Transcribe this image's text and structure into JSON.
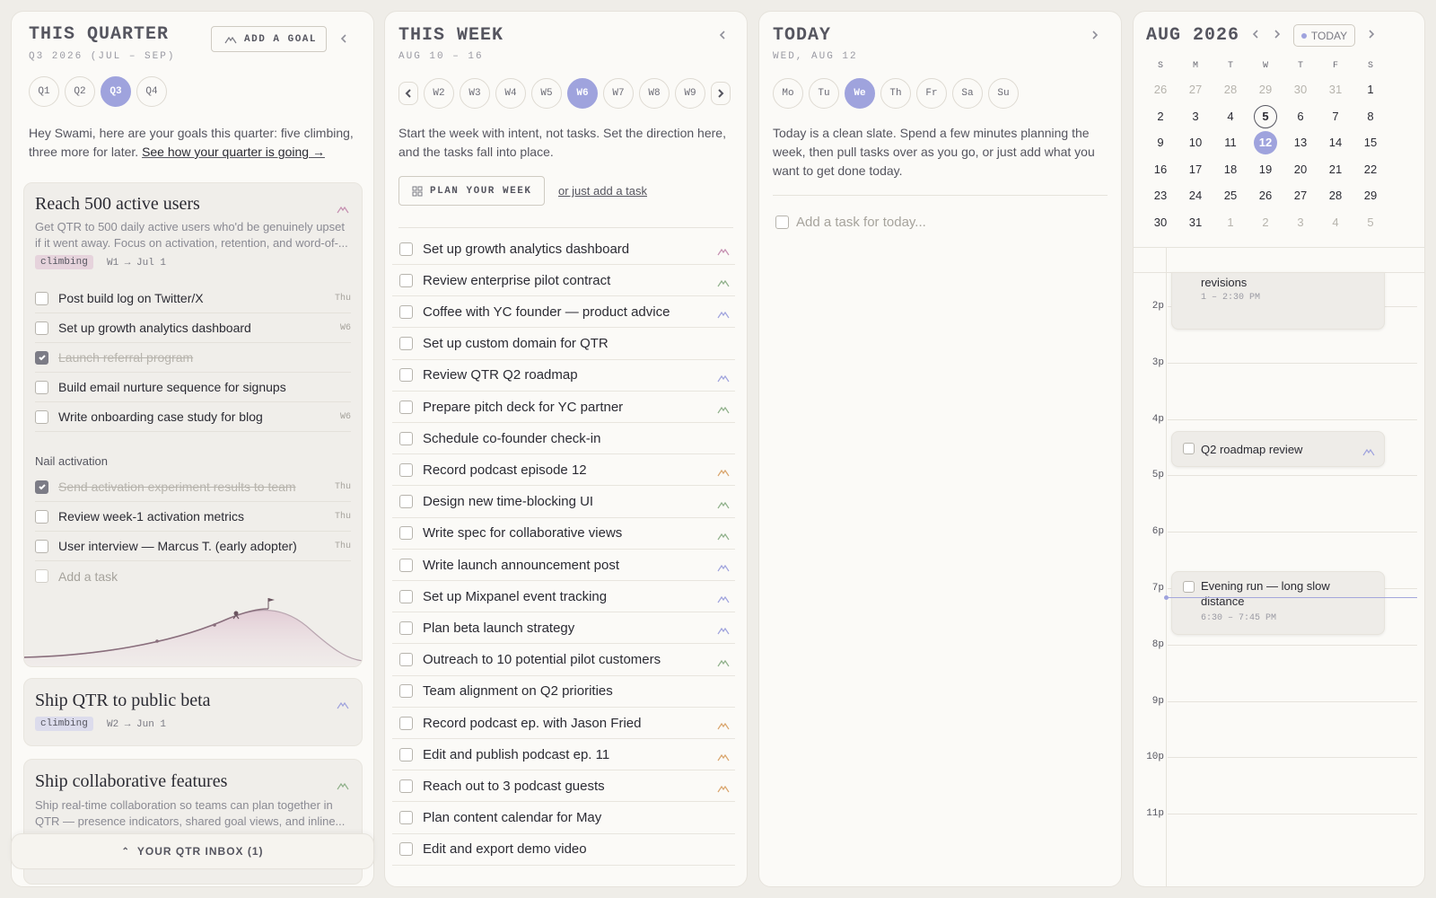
{
  "quarter": {
    "title": "THIS QUARTER",
    "subtitle": "Q3 2026 (JUL – SEP)",
    "add_goal_label": "ADD A GOAL",
    "quarters": [
      "Q1",
      "Q2",
      "Q3",
      "Q4"
    ],
    "active_quarter": "Q3",
    "intro": "Hey Swami, here are your goals this quarter: five climbing, three more for later.",
    "intro_link": "See how your quarter is going →",
    "goals": [
      {
        "title": "Reach 500 active users",
        "description": "Get QTR to 500 daily active users who'd be genuinely upset if it went away. Focus on activation, retention, and word-of-...",
        "status": "climbing",
        "span": "W1 → Jul 1",
        "tasks": [
          {
            "label": "Post build log on Twitter/X",
            "due": "Thu",
            "done": false
          },
          {
            "label": "Set up growth analytics dashboard",
            "due": "W6",
            "done": false
          },
          {
            "label": "Launch referral program",
            "due": "",
            "done": true
          },
          {
            "label": "Build email nurture sequence for signups",
            "due": "",
            "done": false
          },
          {
            "label": "Write onboarding case study for blog",
            "due": "W6",
            "done": false
          }
        ],
        "subgoal_title": "Nail activation",
        "subgoal_tasks": [
          {
            "label": "Send activation experiment results to team",
            "due": "Thu",
            "done": true
          },
          {
            "label": "Review week-1 activation metrics",
            "due": "Thu",
            "done": false
          },
          {
            "label": "User interview — Marcus T. (early adopter)",
            "due": "Thu",
            "done": false
          }
        ],
        "add_task_placeholder": "Add a task",
        "progress": 0.6
      },
      {
        "title": "Ship QTR to public beta",
        "status": "climbing",
        "span": "W2 → Jun 1"
      },
      {
        "title": "Ship collaborative features",
        "description": "Ship real-time collaboration so teams can plan together in QTR — presence indicators, shared goal views, and inline..."
      }
    ],
    "inbox_label": "YOUR QTR INBOX (1)"
  },
  "week": {
    "title": "THIS WEEK",
    "subtitle": "AUG 10 – 16",
    "weeks": [
      "W2",
      "W3",
      "W4",
      "W5",
      "W6",
      "W7",
      "W8",
      "W9"
    ],
    "active_week": "W6",
    "intro": "Start the week with intent, not tasks. Set the direction here, and the tasks fall into place.",
    "plan_label": "PLAN YOUR WEEK",
    "add_task_link": "or just add a task",
    "tasks": [
      {
        "label": "Set up growth analytics dashboard",
        "goal_color": "#c58fb0"
      },
      {
        "label": "Review enterprise pilot contract",
        "goal_color": "#8fb08a"
      },
      {
        "label": "Coffee with YC founder — product advice",
        "goal_color": "#9fa3dd"
      },
      {
        "label": "Set up custom domain for QTR",
        "goal_color": ""
      },
      {
        "label": "Review QTR Q2 roadmap",
        "goal_color": "#9fa3dd"
      },
      {
        "label": "Prepare pitch deck for YC partner",
        "goal_color": "#8fb08a"
      },
      {
        "label": "Schedule co-founder check-in",
        "goal_color": ""
      },
      {
        "label": "Record podcast episode 12",
        "goal_color": "#d9a56c"
      },
      {
        "label": "Design new time-blocking UI",
        "goal_color": "#8fb08a"
      },
      {
        "label": "Write spec for collaborative views",
        "goal_color": "#8fb08a"
      },
      {
        "label": "Write launch announcement post",
        "goal_color": "#9fa3dd"
      },
      {
        "label": "Set up Mixpanel event tracking",
        "goal_color": "#9fa3dd"
      },
      {
        "label": "Plan beta launch strategy",
        "goal_color": "#9fa3dd"
      },
      {
        "label": "Outreach to 10 potential pilot customers",
        "goal_color": "#8fb08a"
      },
      {
        "label": "Team alignment on Q2 priorities",
        "goal_color": ""
      },
      {
        "label": "Record podcast ep. with Jason Fried",
        "goal_color": "#d9a56c"
      },
      {
        "label": "Edit and publish podcast ep. 11",
        "goal_color": "#d9a56c"
      },
      {
        "label": "Reach out to 3 podcast guests",
        "goal_color": "#d9a56c"
      },
      {
        "label": "Plan content calendar for May",
        "goal_color": ""
      },
      {
        "label": "Edit and export demo video",
        "goal_color": ""
      }
    ]
  },
  "today": {
    "title": "TODAY",
    "subtitle": "WED, AUG 12",
    "days": [
      "Mo",
      "Tu",
      "We",
      "Th",
      "Fr",
      "Sa",
      "Su"
    ],
    "active_day": "We",
    "intro": "Today is a clean slate. Spend a few minutes planning the week, then pull tasks over as you go, or just add what you want to get done today.",
    "add_placeholder": "Add a task for today..."
  },
  "calendar": {
    "month_title": "AUG 2026",
    "today_label": "TODAY",
    "weekdays": [
      "S",
      "M",
      "T",
      "W",
      "T",
      "F",
      "S"
    ],
    "weeks": [
      [
        {
          "d": "26",
          "m": true
        },
        {
          "d": "27",
          "m": true
        },
        {
          "d": "28",
          "m": true
        },
        {
          "d": "29",
          "m": true
        },
        {
          "d": "30",
          "m": true
        },
        {
          "d": "31",
          "m": true
        },
        {
          "d": "1"
        }
      ],
      [
        {
          "d": "2"
        },
        {
          "d": "3"
        },
        {
          "d": "4"
        },
        {
          "d": "5",
          "ring": true
        },
        {
          "d": "6"
        },
        {
          "d": "7"
        },
        {
          "d": "8"
        }
      ],
      [
        {
          "d": "9"
        },
        {
          "d": "10"
        },
        {
          "d": "11"
        },
        {
          "d": "12",
          "sel": true
        },
        {
          "d": "13"
        },
        {
          "d": "14"
        },
        {
          "d": "15"
        }
      ],
      [
        {
          "d": "16"
        },
        {
          "d": "17"
        },
        {
          "d": "18"
        },
        {
          "d": "19"
        },
        {
          "d": "20"
        },
        {
          "d": "21"
        },
        {
          "d": "22"
        }
      ],
      [
        {
          "d": "23"
        },
        {
          "d": "24"
        },
        {
          "d": "25"
        },
        {
          "d": "26"
        },
        {
          "d": "27"
        },
        {
          "d": "28"
        },
        {
          "d": "29"
        }
      ],
      [
        {
          "d": "30"
        },
        {
          "d": "31"
        },
        {
          "d": "1",
          "m": true
        },
        {
          "d": "2",
          "m": true
        },
        {
          "d": "3",
          "m": true
        },
        {
          "d": "4",
          "m": true
        },
        {
          "d": "5",
          "m": true
        }
      ]
    ],
    "hours": [
      "2p",
      "3p",
      "4p",
      "5p",
      "6p",
      "7p",
      "8p",
      "9p",
      "10p",
      "11p"
    ],
    "events": [
      {
        "title": "revisions",
        "time": "1 – 2:30 PM",
        "checkbox": false
      },
      {
        "title": "Q2 roadmap review",
        "time": "",
        "checkbox": true
      },
      {
        "title": "Evening run — long slow distance",
        "time": "6:30 – 7:45 PM",
        "checkbox": true
      }
    ]
  },
  "colors": {
    "accent": "#9fa3dd",
    "rose": "#c58fb0",
    "sage": "#8fb08a",
    "amber": "#d9a56c"
  }
}
